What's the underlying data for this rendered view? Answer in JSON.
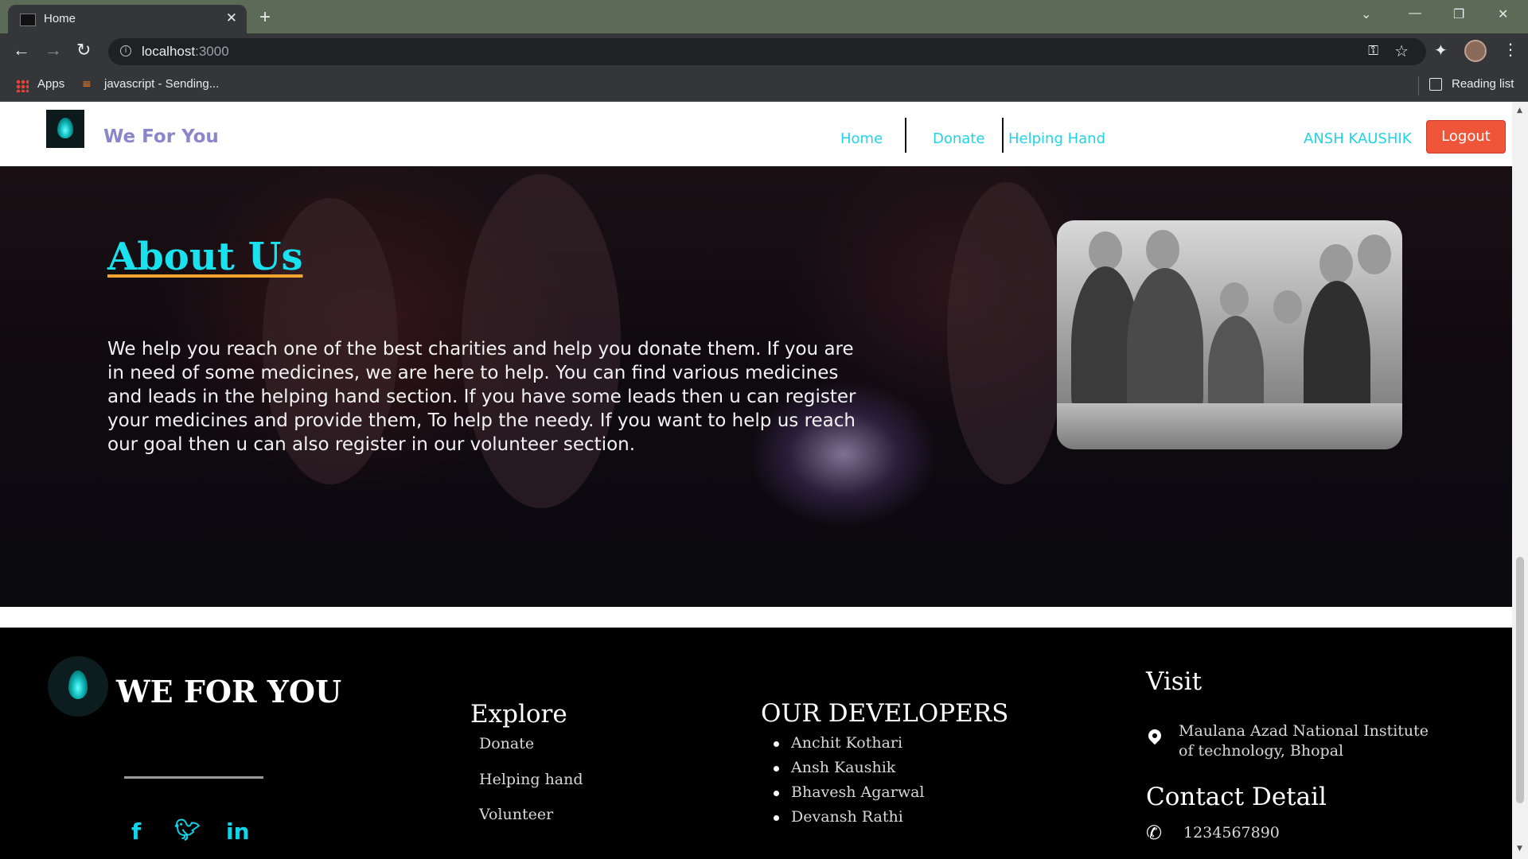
{
  "browser": {
    "tab_title": "Home",
    "url_host": "localhost",
    "url_port": ":3000",
    "bookmarks": {
      "apps": "Apps",
      "item1": "javascript - Sending...",
      "reading_list": "Reading list"
    }
  },
  "nav": {
    "brand": "We For You",
    "links": [
      "Home",
      "Donate",
      "Helping Hand"
    ],
    "user": "ANSH KAUSHIK",
    "logout": "Logout"
  },
  "about": {
    "title": "About Us",
    "text": "We help you reach one of the best charities and help you donate them. If you are in need of some medicines, we are here to help. You can find various medicines and leads in the helping hand section. If you have some leads then u can register your medicines and provide them, To help the needy. If you want to help us reach our goal then u can also register in our volunteer section."
  },
  "footer": {
    "brand": "WE FOR YOU",
    "explore_heading": "Explore",
    "explore_links": [
      "Donate",
      "Helping hand",
      "Volunteer"
    ],
    "developers_heading": "OUR DEVELOPERS",
    "developers": [
      "Anchit Kothari",
      "Ansh Kaushik",
      "Bhavesh Agarwal",
      "Devansh Rathi"
    ],
    "visit_heading": "Visit",
    "address": "Maulana Azad National Institute of technology, Bhopal",
    "contact_heading": "Contact Detail",
    "phone": "1234567890",
    "social": [
      "f",
      "twitter",
      "in"
    ]
  },
  "colors": {
    "accent": "#22d3e6",
    "logout": "#ef5538",
    "brand": "#8a86c9"
  }
}
